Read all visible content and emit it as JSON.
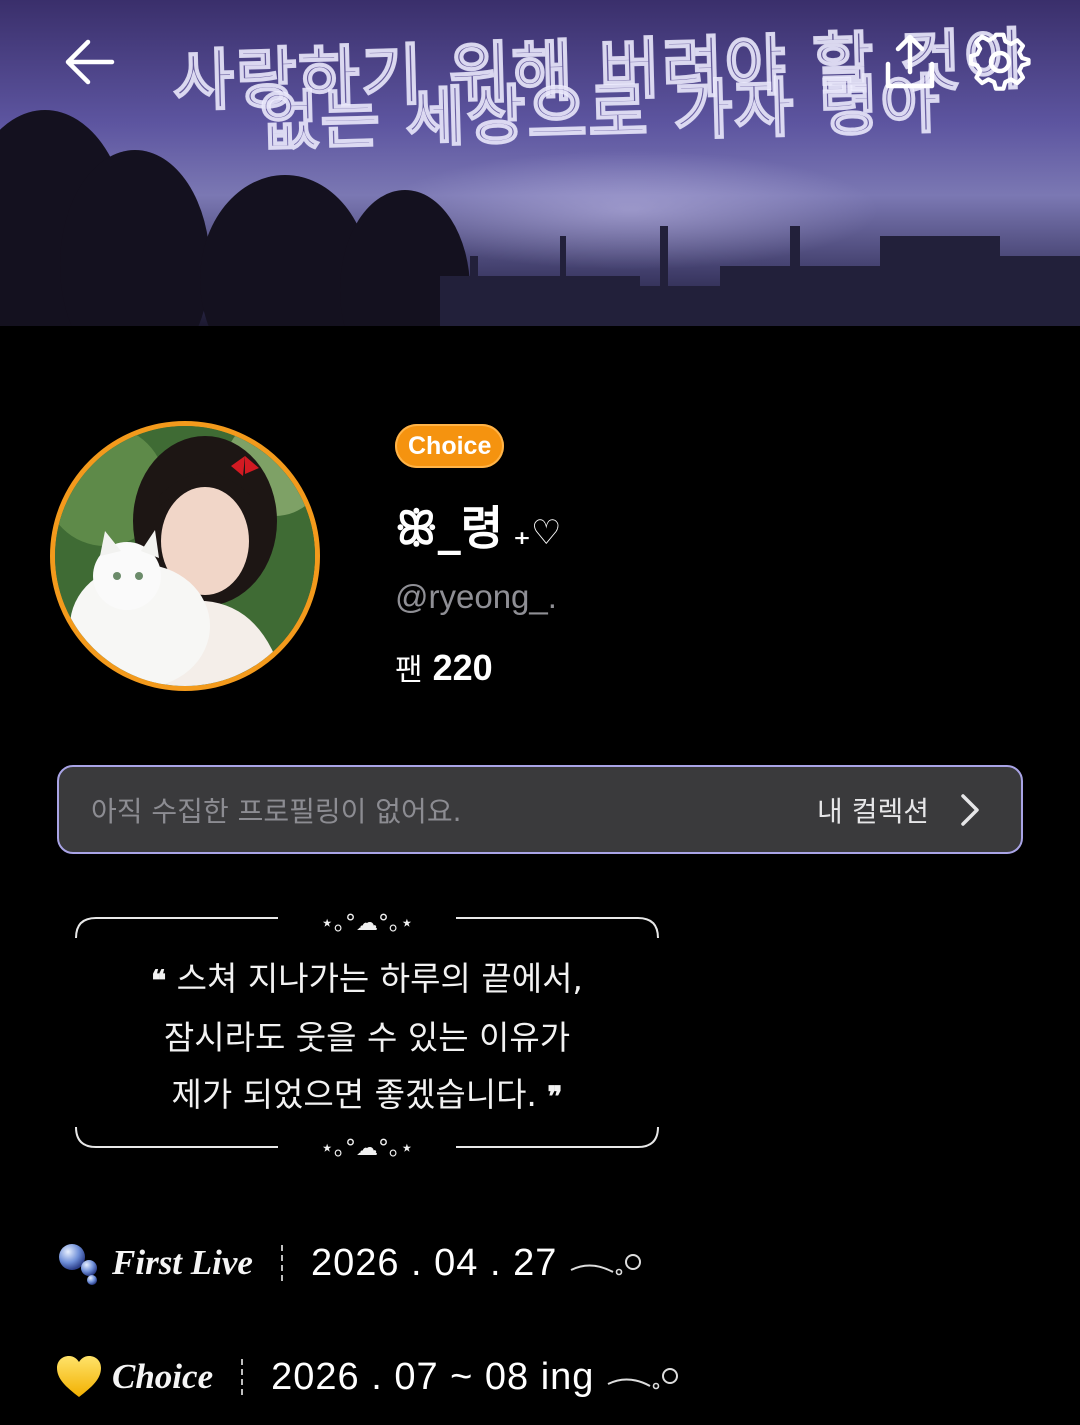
{
  "banner": {
    "title_line1": "사랑하기 위해 버려야 할 것이",
    "title_line2": "없는 세상으로 가자 령아"
  },
  "header": {
    "back_icon": "arrow-left-icon",
    "share_icon": "share-upload-icon",
    "settings_icon": "gear-icon"
  },
  "profile": {
    "badge": "Choice",
    "nickname": "ꕥ_령",
    "nickname_decoration": "₊♡",
    "handle": "@ryeong_.",
    "fans_label": "팬",
    "fans_count": "220",
    "accent_color": "#f5930f"
  },
  "collection": {
    "empty_text": "아직 수집한 프로필링이 없어요.",
    "link_label": "내 컬렉션"
  },
  "quote": {
    "open_mark": "❝",
    "line1": "스쳐 지나가는 하루의 끝에서,",
    "line2": "잠시라도 웃을 수 있는 이유가",
    "line3": "제가 되었으면 좋겠습니다.",
    "close_mark": "❞",
    "frame_ornament": "⋆｡°☁︎°｡⋆"
  },
  "info_rows": [
    {
      "icon": "bubbles-icon",
      "label": "First Live",
      "value": "2026 . 04 . 27"
    },
    {
      "icon": "yellow-heart-icon",
      "label": "Choice",
      "value": "2026 . 07 ~ 08 ing"
    }
  ]
}
